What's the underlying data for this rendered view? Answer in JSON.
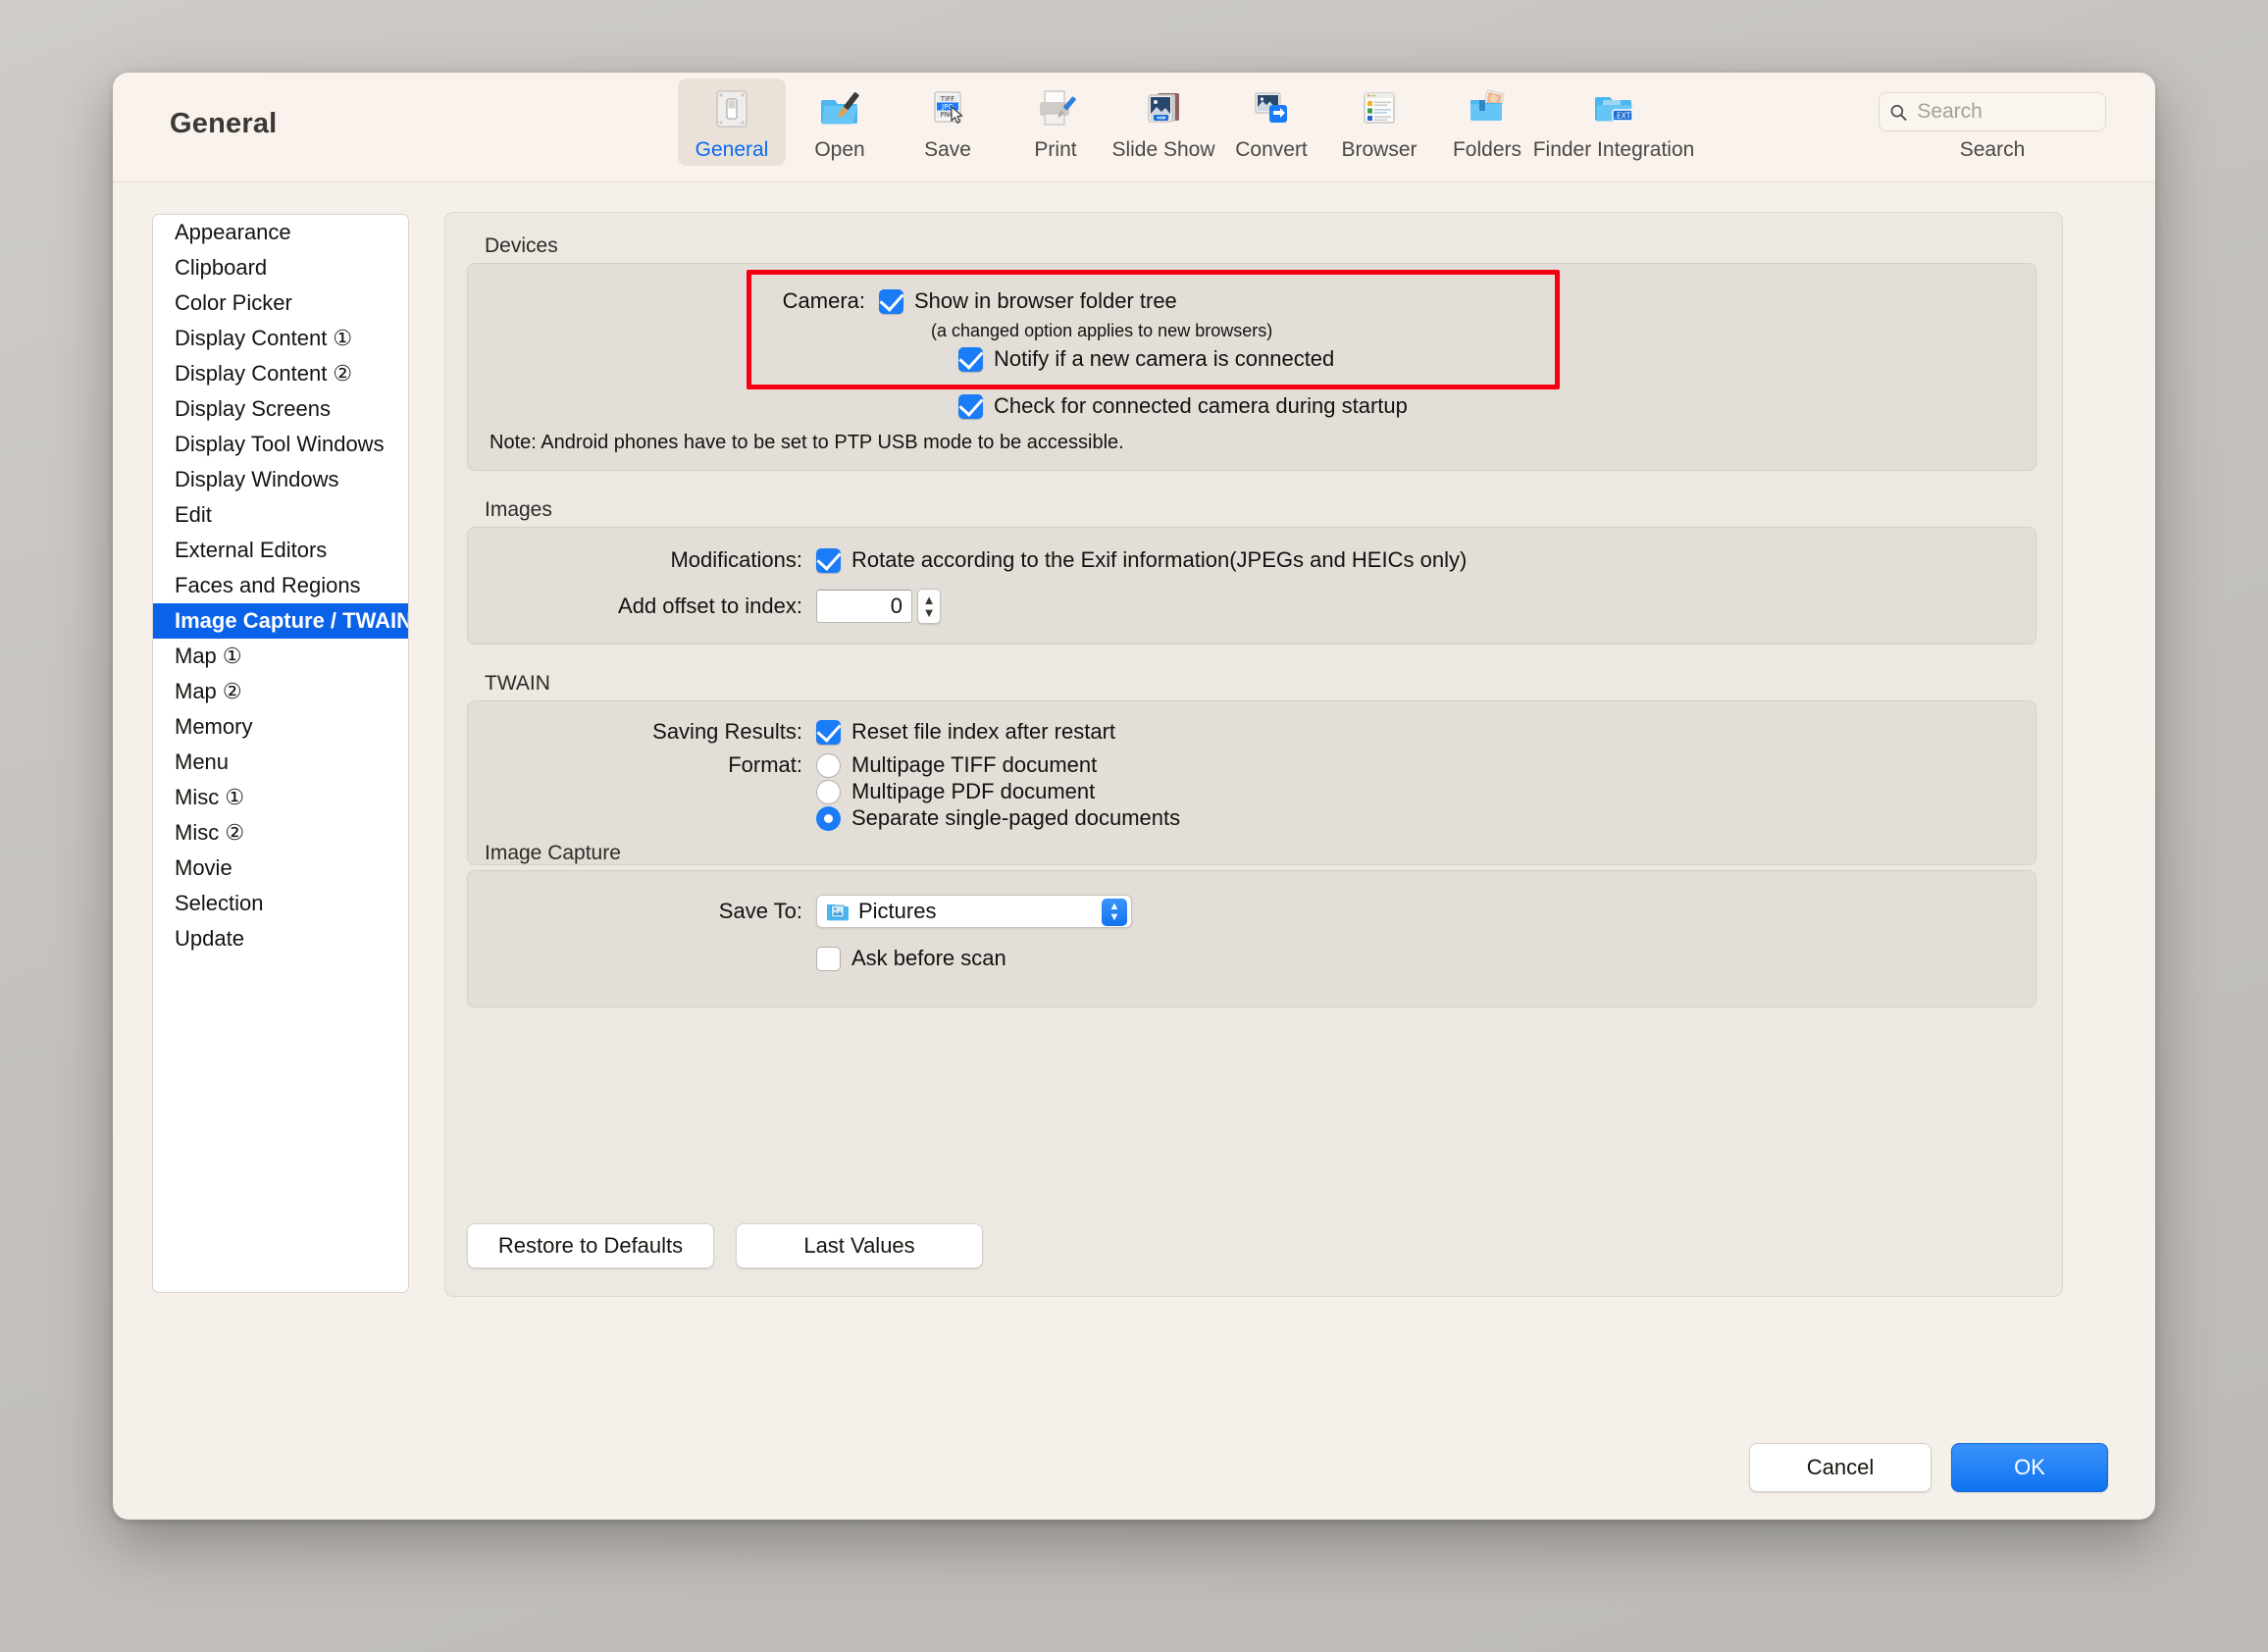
{
  "window": {
    "title": "General"
  },
  "toolbar": {
    "items": [
      {
        "label": "General",
        "icon": "switch-panel-icon",
        "selected": true
      },
      {
        "label": "Open",
        "icon": "folder-brush-icon",
        "selected": false
      },
      {
        "label": "Save",
        "icon": "file-formats-icon",
        "selected": false
      },
      {
        "label": "Print",
        "icon": "printer-icon",
        "selected": false
      },
      {
        "label": "Slide Show",
        "icon": "slideshow-icon",
        "selected": false
      },
      {
        "label": "Convert",
        "icon": "convert-arrow-icon",
        "selected": false
      },
      {
        "label": "Browser",
        "icon": "browser-window-icon",
        "selected": false
      },
      {
        "label": "Folders",
        "icon": "folder-photos-icon",
        "selected": false
      },
      {
        "label": "Finder Integration",
        "icon": "folder-ext-icon",
        "selected": false
      }
    ],
    "search": {
      "placeholder": "Search",
      "value": "",
      "caption": "Search",
      "icon": "search-icon"
    }
  },
  "sidebar": {
    "items": [
      {
        "label": "Appearance",
        "selected": false
      },
      {
        "label": "Clipboard",
        "selected": false
      },
      {
        "label": "Color Picker",
        "selected": false
      },
      {
        "label": "Display Content ①",
        "selected": false
      },
      {
        "label": "Display Content ②",
        "selected": false
      },
      {
        "label": "Display Screens",
        "selected": false
      },
      {
        "label": "Display Tool Windows",
        "selected": false
      },
      {
        "label": "Display Windows",
        "selected": false
      },
      {
        "label": "Edit",
        "selected": false
      },
      {
        "label": "External Editors",
        "selected": false
      },
      {
        "label": "Faces and Regions",
        "selected": false
      },
      {
        "label": "Image Capture / TWAIN",
        "selected": true
      },
      {
        "label": "Map ①",
        "selected": false
      },
      {
        "label": "Map ②",
        "selected": false
      },
      {
        "label": "Memory",
        "selected": false
      },
      {
        "label": "Menu",
        "selected": false
      },
      {
        "label": "Misc ①",
        "selected": false
      },
      {
        "label": "Misc ②",
        "selected": false
      },
      {
        "label": "Movie",
        "selected": false
      },
      {
        "label": "Selection",
        "selected": false
      },
      {
        "label": "Update",
        "selected": false
      }
    ]
  },
  "devices": {
    "group_title": "Devices",
    "camera_label": "Camera:",
    "show_in_tree": {
      "label": "Show in browser folder tree",
      "checked": true
    },
    "hint": "(a changed option applies to new browsers)",
    "notify_new_camera": {
      "label": "Notify if a new camera is connected",
      "checked": true
    },
    "check_on_startup": {
      "label": "Check for connected camera during startup",
      "checked": true
    },
    "note": "Note: Android phones have to be set to PTP USB mode to be accessible.",
    "highlight_color": "#f50012"
  },
  "images": {
    "group_title": "Images",
    "modifications_label": "Modifications:",
    "rotate_exif": {
      "label": "Rotate according to the Exif information(JPEGs and HEICs only)",
      "checked": true
    },
    "offset_label": "Add offset to index:",
    "offset_value": "0"
  },
  "twain": {
    "group_title": "TWAIN",
    "saving_results_label": "Saving Results:",
    "reset_index": {
      "label": "Reset file index after restart",
      "checked": true
    },
    "format_label": "Format:",
    "format_options": [
      {
        "label": "Multipage TIFF document",
        "selected": false
      },
      {
        "label": "Multipage PDF document",
        "selected": false
      },
      {
        "label": "Separate single-paged documents",
        "selected": true
      }
    ]
  },
  "image_capture": {
    "group_title": "Image Capture",
    "save_to_label": "Save To:",
    "save_to_value": "Pictures",
    "save_to_icon": "pictures-folder-icon",
    "ask_before_scan": {
      "label": "Ask before scan",
      "checked": false
    }
  },
  "actions": {
    "restore_defaults": "Restore to Defaults",
    "last_values": "Last Values",
    "cancel": "Cancel",
    "ok": "OK"
  },
  "colors": {
    "accent": "#1a7cf7",
    "selection": "#0a62e8",
    "highlight": "#f50012"
  }
}
